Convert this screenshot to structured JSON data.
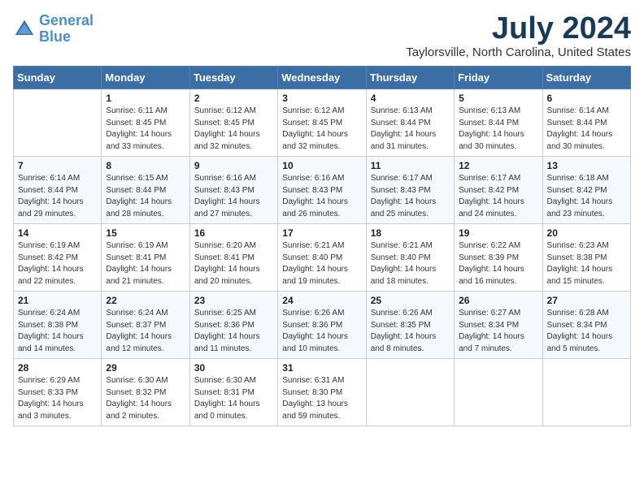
{
  "header": {
    "logo_line1": "General",
    "logo_line2": "Blue",
    "month": "July 2024",
    "location": "Taylorsville, North Carolina, United States"
  },
  "weekdays": [
    "Sunday",
    "Monday",
    "Tuesday",
    "Wednesday",
    "Thursday",
    "Friday",
    "Saturday"
  ],
  "weeks": [
    [
      {
        "day": "",
        "info": ""
      },
      {
        "day": "1",
        "info": "Sunrise: 6:11 AM\nSunset: 8:45 PM\nDaylight: 14 hours\nand 33 minutes."
      },
      {
        "day": "2",
        "info": "Sunrise: 6:12 AM\nSunset: 8:45 PM\nDaylight: 14 hours\nand 32 minutes."
      },
      {
        "day": "3",
        "info": "Sunrise: 6:12 AM\nSunset: 8:45 PM\nDaylight: 14 hours\nand 32 minutes."
      },
      {
        "day": "4",
        "info": "Sunrise: 6:13 AM\nSunset: 8:44 PM\nDaylight: 14 hours\nand 31 minutes."
      },
      {
        "day": "5",
        "info": "Sunrise: 6:13 AM\nSunset: 8:44 PM\nDaylight: 14 hours\nand 30 minutes."
      },
      {
        "day": "6",
        "info": "Sunrise: 6:14 AM\nSunset: 8:44 PM\nDaylight: 14 hours\nand 30 minutes."
      }
    ],
    [
      {
        "day": "7",
        "info": "Sunrise: 6:14 AM\nSunset: 8:44 PM\nDaylight: 14 hours\nand 29 minutes."
      },
      {
        "day": "8",
        "info": "Sunrise: 6:15 AM\nSunset: 8:44 PM\nDaylight: 14 hours\nand 28 minutes."
      },
      {
        "day": "9",
        "info": "Sunrise: 6:16 AM\nSunset: 8:43 PM\nDaylight: 14 hours\nand 27 minutes."
      },
      {
        "day": "10",
        "info": "Sunrise: 6:16 AM\nSunset: 8:43 PM\nDaylight: 14 hours\nand 26 minutes."
      },
      {
        "day": "11",
        "info": "Sunrise: 6:17 AM\nSunset: 8:43 PM\nDaylight: 14 hours\nand 25 minutes."
      },
      {
        "day": "12",
        "info": "Sunrise: 6:17 AM\nSunset: 8:42 PM\nDaylight: 14 hours\nand 24 minutes."
      },
      {
        "day": "13",
        "info": "Sunrise: 6:18 AM\nSunset: 8:42 PM\nDaylight: 14 hours\nand 23 minutes."
      }
    ],
    [
      {
        "day": "14",
        "info": "Sunrise: 6:19 AM\nSunset: 8:42 PM\nDaylight: 14 hours\nand 22 minutes."
      },
      {
        "day": "15",
        "info": "Sunrise: 6:19 AM\nSunset: 8:41 PM\nDaylight: 14 hours\nand 21 minutes."
      },
      {
        "day": "16",
        "info": "Sunrise: 6:20 AM\nSunset: 8:41 PM\nDaylight: 14 hours\nand 20 minutes."
      },
      {
        "day": "17",
        "info": "Sunrise: 6:21 AM\nSunset: 8:40 PM\nDaylight: 14 hours\nand 19 minutes."
      },
      {
        "day": "18",
        "info": "Sunrise: 6:21 AM\nSunset: 8:40 PM\nDaylight: 14 hours\nand 18 minutes."
      },
      {
        "day": "19",
        "info": "Sunrise: 6:22 AM\nSunset: 8:39 PM\nDaylight: 14 hours\nand 16 minutes."
      },
      {
        "day": "20",
        "info": "Sunrise: 6:23 AM\nSunset: 8:38 PM\nDaylight: 14 hours\nand 15 minutes."
      }
    ],
    [
      {
        "day": "21",
        "info": "Sunrise: 6:24 AM\nSunset: 8:38 PM\nDaylight: 14 hours\nand 14 minutes."
      },
      {
        "day": "22",
        "info": "Sunrise: 6:24 AM\nSunset: 8:37 PM\nDaylight: 14 hours\nand 12 minutes."
      },
      {
        "day": "23",
        "info": "Sunrise: 6:25 AM\nSunset: 8:36 PM\nDaylight: 14 hours\nand 11 minutes."
      },
      {
        "day": "24",
        "info": "Sunrise: 6:26 AM\nSunset: 8:36 PM\nDaylight: 14 hours\nand 10 minutes."
      },
      {
        "day": "25",
        "info": "Sunrise: 6:26 AM\nSunset: 8:35 PM\nDaylight: 14 hours\nand 8 minutes."
      },
      {
        "day": "26",
        "info": "Sunrise: 6:27 AM\nSunset: 8:34 PM\nDaylight: 14 hours\nand 7 minutes."
      },
      {
        "day": "27",
        "info": "Sunrise: 6:28 AM\nSunset: 8:34 PM\nDaylight: 14 hours\nand 5 minutes."
      }
    ],
    [
      {
        "day": "28",
        "info": "Sunrise: 6:29 AM\nSunset: 8:33 PM\nDaylight: 14 hours\nand 3 minutes."
      },
      {
        "day": "29",
        "info": "Sunrise: 6:30 AM\nSunset: 8:32 PM\nDaylight: 14 hours\nand 2 minutes."
      },
      {
        "day": "30",
        "info": "Sunrise: 6:30 AM\nSunset: 8:31 PM\nDaylight: 14 hours\nand 0 minutes."
      },
      {
        "day": "31",
        "info": "Sunrise: 6:31 AM\nSunset: 8:30 PM\nDaylight: 13 hours\nand 59 minutes."
      },
      {
        "day": "",
        "info": ""
      },
      {
        "day": "",
        "info": ""
      },
      {
        "day": "",
        "info": ""
      }
    ]
  ]
}
